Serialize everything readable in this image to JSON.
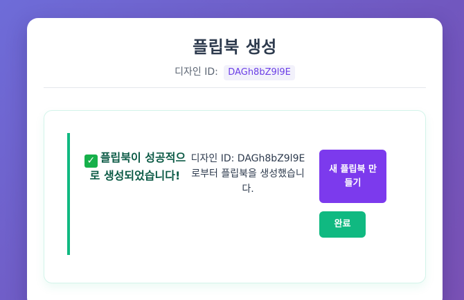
{
  "header": {
    "title": "플립북 생성",
    "design_id_label": "디자인 ID:",
    "design_id_value": "DAGh8bZ9l9E"
  },
  "result": {
    "success_icon": "check-mark-icon",
    "success_text": "플립북이 성공적으로 생성되었습니다!",
    "detail_text": "디자인 ID: DAGh8bZ9l9E로부터 플립북을 생성했습니다.",
    "new_button_label": "새 플립북 만들기",
    "done_button_label": "완료"
  },
  "colors": {
    "primary": "#7c3aed",
    "success": "#10b981",
    "title": "#2d3a4d"
  }
}
